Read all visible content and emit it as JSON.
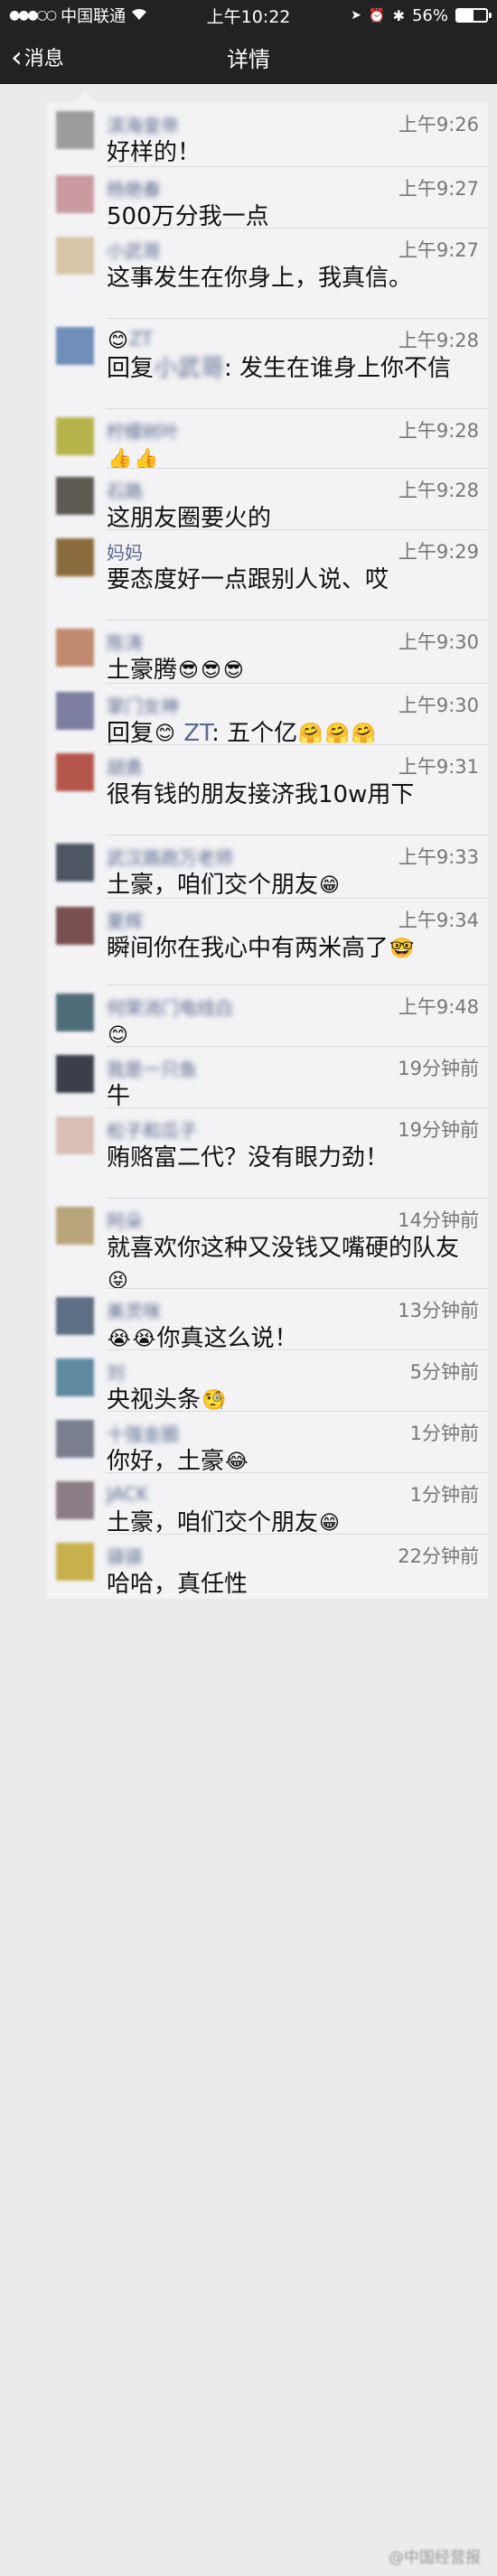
{
  "status_bar": {
    "carrier": "中国联通",
    "time": "上午10:22",
    "battery": "56%",
    "battery_level": 0.56
  },
  "nav": {
    "back_label": "消息",
    "title": "详情"
  },
  "comments": [
    {
      "name": "滨海皇帝",
      "time": "上午9:26",
      "parts": [
        {
          "t": "好样的！"
        }
      ],
      "avatar": "#9c9c9c",
      "name_blur": true
    },
    {
      "name": "杨艳春",
      "time": "上午9:27",
      "parts": [
        {
          "t": "500万分我一点"
        }
      ],
      "avatar": "#c99aa0",
      "name_blur": true
    },
    {
      "name": "小武哥",
      "time": "上午9:27",
      "parts": [
        {
          "t": "这事发生在你身上，我真信。"
        }
      ],
      "avatar": "#d7c7a8",
      "name_blur": true
    },
    {
      "name": "ZT",
      "time": "上午9:28",
      "parts": [
        {
          "t": "回复"
        },
        {
          "link": "小武哥",
          "blur": true
        },
        {
          "t": ": 发生在谁身上你不信"
        }
      ],
      "avatar": "#6f8fb8",
      "name_blur": true,
      "name_emoji": "😊"
    },
    {
      "name": "柠檬树叶",
      "time": "上午9:28",
      "parts": [
        {
          "e": "👍"
        },
        {
          "e": "👍"
        }
      ],
      "avatar": "#b6b34a",
      "name_blur": true
    },
    {
      "name": "石路",
      "time": "上午9:28",
      "parts": [
        {
          "t": "这朋友圈要火的"
        }
      ],
      "avatar": "#5d5a52",
      "name_blur": true
    },
    {
      "name": "妈妈",
      "time": "上午9:29",
      "parts": [
        {
          "t": "要态度好一点跟别人说、哎"
        }
      ],
      "avatar": "#8a6b3d",
      "name_blur": false
    },
    {
      "name": "陈涛",
      "time": "上午9:30",
      "parts": [
        {
          "t": "土豪腾"
        },
        {
          "e": "😎"
        },
        {
          "e": "😎"
        },
        {
          "e": "😎"
        }
      ],
      "avatar": "#c08a6e",
      "name_blur": true
    },
    {
      "name": "掌门女神",
      "time": "上午9:30",
      "parts": [
        {
          "t": "回复"
        },
        {
          "e": "😊"
        },
        {
          "link": " ZT",
          "blur": false
        },
        {
          "t": ": 五个亿"
        },
        {
          "e": "🤗"
        },
        {
          "e": "🤗"
        },
        {
          "e": "🤗"
        }
      ],
      "avatar": "#7d7fa0",
      "name_blur": true
    },
    {
      "name": "胡勇",
      "time": "上午9:31",
      "parts": [
        {
          "t": "很有钱的朋友接济我10w用下"
        }
      ],
      "avatar": "#b5564a",
      "name_blur": true
    },
    {
      "name": "武汉路跑万老师",
      "time": "上午9:33",
      "parts": [
        {
          "t": "土豪，咱们交个朋友"
        },
        {
          "e": "😁"
        }
      ],
      "avatar": "#4e5563",
      "name_blur": true
    },
    {
      "name": "夏辉",
      "time": "上午9:34",
      "parts": [
        {
          "t": "瞬间你在我心中有两米高了"
        },
        {
          "e": "🤓"
        }
      ],
      "avatar": "#7a4f4f",
      "name_blur": true
    },
    {
      "name": "何荣消门电线白",
      "time": "上午9:48",
      "parts": [
        {
          "e": "😊"
        }
      ],
      "avatar": "#4f6d78",
      "name_blur": true
    },
    {
      "name": "我是一只鱼",
      "time": "19分钟前",
      "parts": [
        {
          "t": "牛"
        }
      ],
      "avatar": "#3b3f4a",
      "name_blur": true
    },
    {
      "name": "松子和瓜子",
      "time": "19分钟前",
      "parts": [
        {
          "t": "贿赂富二代？没有眼力劲！"
        }
      ],
      "avatar": "#d9c0b4",
      "name_blur": true
    },
    {
      "name": "阿朵",
      "time": "14分钟前",
      "parts": [
        {
          "t": "就喜欢你这种又没钱又嘴硬的队友"
        },
        {
          "e": "😝"
        }
      ],
      "avatar": "#b9a57c",
      "name_blur": true
    },
    {
      "name": "美灵咪",
      "time": "13分钟前",
      "parts": [
        {
          "e": "😭"
        },
        {
          "e": "😭"
        },
        {
          "t": "你真这么说！"
        }
      ],
      "avatar": "#5d6f84",
      "name_blur": true
    },
    {
      "name": "刘",
      "time": "5分钟前",
      "parts": [
        {
          "t": "央视头条"
        },
        {
          "e": "🧐"
        }
      ],
      "avatar": "#5f8aa0",
      "name_blur": true
    },
    {
      "name": "十强金圈",
      "time": "1分钟前",
      "parts": [
        {
          "t": "你好，土豪"
        },
        {
          "e": "😂"
        }
      ],
      "avatar": "#7a7f8f",
      "name_blur": true
    },
    {
      "name": "JACK",
      "time": "1分钟前",
      "parts": [
        {
          "t": "土豪，咱们交个朋友"
        },
        {
          "e": "😁"
        }
      ],
      "avatar": "#8c7d86",
      "name_blur": true
    },
    {
      "name": "驿驿",
      "time": "22分钟前",
      "parts": [
        {
          "t": "哈哈，真任性"
        }
      ],
      "avatar": "#c8b04e",
      "name_blur": true
    }
  ],
  "watermark": "@中国经营报"
}
